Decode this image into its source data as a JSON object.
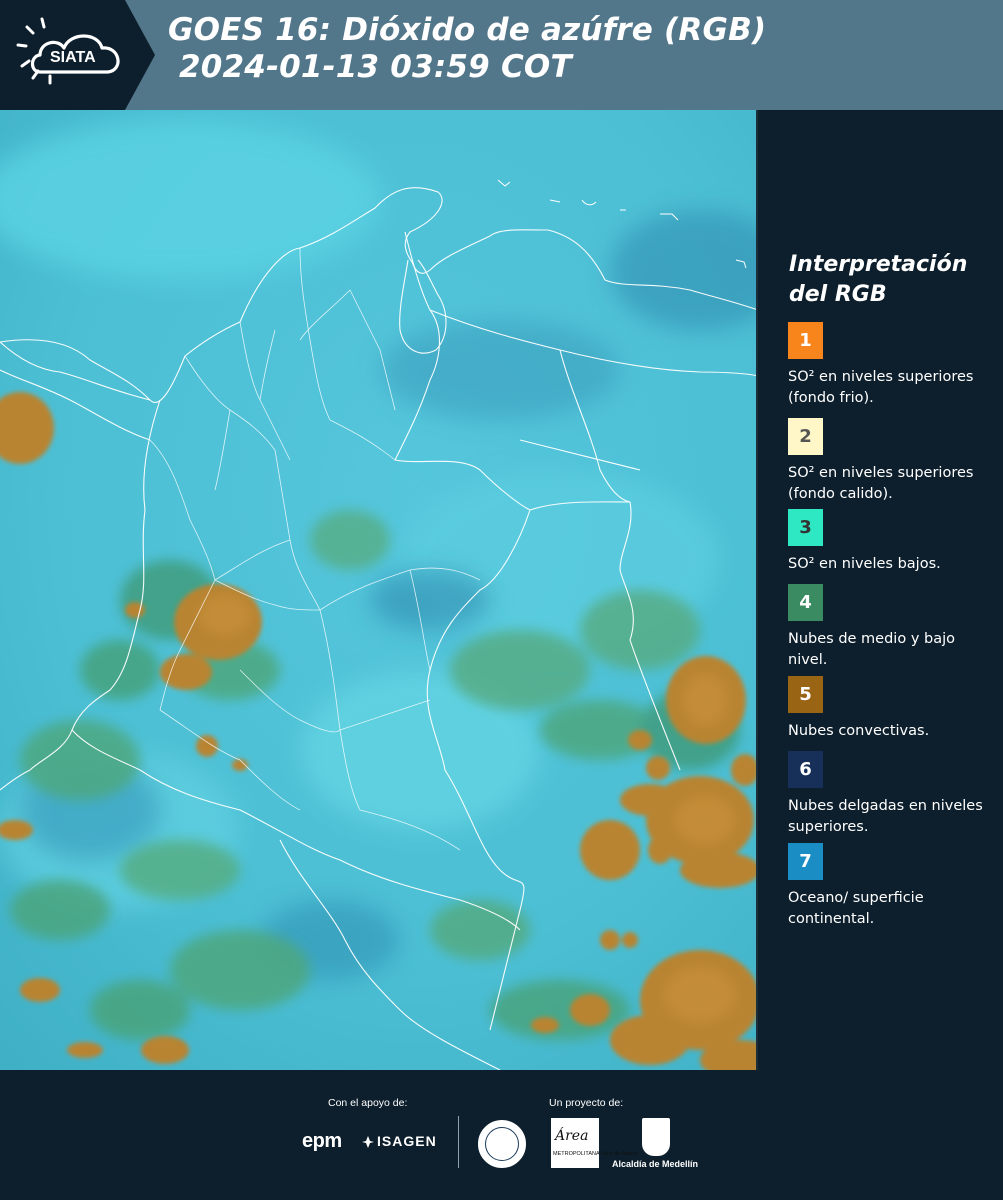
{
  "header": {
    "logo_text": "SIATA",
    "title_line1": "GOES 16: Dióxido de azúfre (RGB)",
    "title_line2": " 2024-01-13 03:59 COT"
  },
  "legend": {
    "title": "Interpretación del RGB",
    "items": [
      {
        "number": "1",
        "text": "SO² en niveles superiores (fondo frio).",
        "color": "#f7851c",
        "num_color": "#ffffff"
      },
      {
        "number": "2",
        "text": "SO² en niveles superiores (fondo calido).",
        "color": "#fff7c8",
        "num_color": "#555555"
      },
      {
        "number": "3",
        "text": "SO² en niveles bajos.",
        "color": "#2ee8c4",
        "num_color": "#333333"
      },
      {
        "number": "4",
        "text": "Nubes de medio y bajo nivel.",
        "color": "#3a8a62",
        "num_color": "#ffffff"
      },
      {
        "number": "5",
        "text": "Nubes convectivas.",
        "color": "#9a6415",
        "num_color": "#ffffff"
      },
      {
        "number": "6",
        "text": "Nubes delgadas en niveles superiores.",
        "color": "#16305a",
        "num_color": "#ffffff"
      },
      {
        "number": "7",
        "text": "Oceano/ superficie continental.",
        "color": "#1a8ec4",
        "num_color": "#ffffff"
      }
    ]
  },
  "footer": {
    "support_label": "Con el apoyo de:",
    "project_label": "Un proyecto de:",
    "sponsor_epm": "epm",
    "sponsor_isagen": "ISAGEN",
    "area_title": "Área",
    "area_sub": "METROPOLITANA Valle de Aburrá",
    "alcaldia": "Alcaldía de Medellín"
  },
  "colors": {
    "header_bg": "#53778a",
    "logo_bg": "#0d1f2c",
    "panel_bg": "#0d1f2c",
    "map_base": "#4fc3d6",
    "convective": "#b7822f",
    "mid_low_clouds": "#3f9d82",
    "border_lines": "#ffffff"
  }
}
